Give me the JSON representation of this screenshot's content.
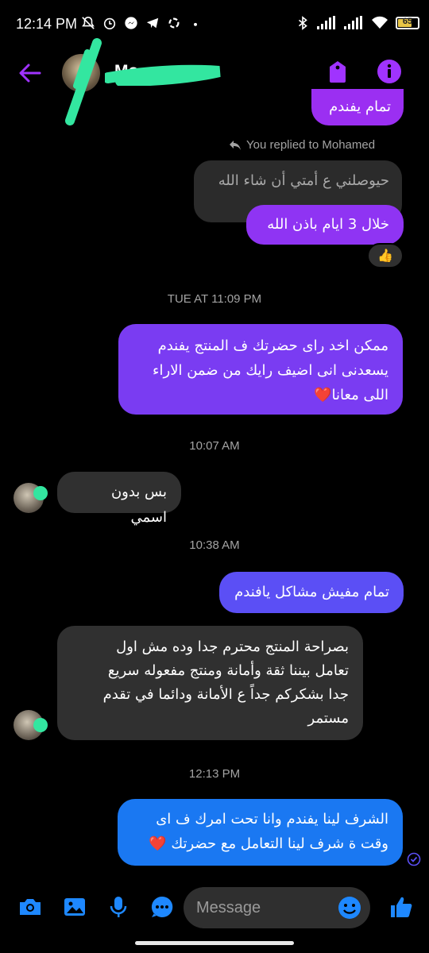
{
  "status_bar": {
    "time": "12:14 PM",
    "battery_level": "65",
    "battery_fraction": 0.65,
    "icons_left": [
      "mute-icon",
      "alarm-icon",
      "messenger-icon",
      "telegram-icon",
      "sync-icon",
      "dot-icon"
    ],
    "icons_right": [
      "bluetooth-icon",
      "signal-icon",
      "signal-icon",
      "wifi-icon",
      "battery-icon"
    ]
  },
  "header": {
    "contact_name": "Mo",
    "back_icon": "arrow-left-icon",
    "tag_icon": "tag-icon",
    "info_icon": "info-icon",
    "accent": "#a033ff"
  },
  "messages": {
    "top_partial": "تمام يفندم",
    "replied_note": "You replied to Mohamed",
    "quoted_text": "حيوصلني ع أمتي أن شاء الله",
    "out_1": "خلال 3 ايام باذن الله",
    "reaction_1": "👍",
    "ts_1": "TUE AT 11:09 PM",
    "out_2_lines": [
      "ممكن اخد راى حضرتك ف المنتج يفندم",
      "يسعدنى انى اضيف رايك من ضمن الاراء",
      "اللى معانا❤️"
    ],
    "ts_2": "10:07 AM",
    "in_1": "بس بدون اسمي",
    "ts_3": "10:38 AM",
    "out_3": "تمام مفيش مشاكل يافندم",
    "in_2_lines": [
      "بصراحة المنتج محترم جدا وده مش اول",
      "تعامل بيننا ثقة وأمانة ومنتج مفعوله سريع",
      "جدا بشكركم جداً ع الأمانة ودائما في تقدم",
      "مستمر"
    ],
    "ts_4": "12:13 PM",
    "out_4_lines": [
      "الشرف لينا يفندم وانا تحت امرك ف اى",
      "وقت ة شرف لينا التعامل مع حضرتك ❤️"
    ]
  },
  "composer": {
    "placeholder": "Message",
    "icons": [
      "camera-icon",
      "gallery-icon",
      "microphone-icon",
      "more-icon",
      "emoji-icon",
      "thumbs-up-icon"
    ],
    "icon_color": "#1e88ff"
  },
  "colors": {
    "bubble_purple": "#9b2ff2",
    "bubble_violet": "#7a3cf2",
    "bubble_blue_violet": "#5b4ff5",
    "bubble_blue": "#1a78f2",
    "bubble_incoming": "#303030",
    "timestamp": "#a3a3a3",
    "scribble": "#33e6a0"
  }
}
